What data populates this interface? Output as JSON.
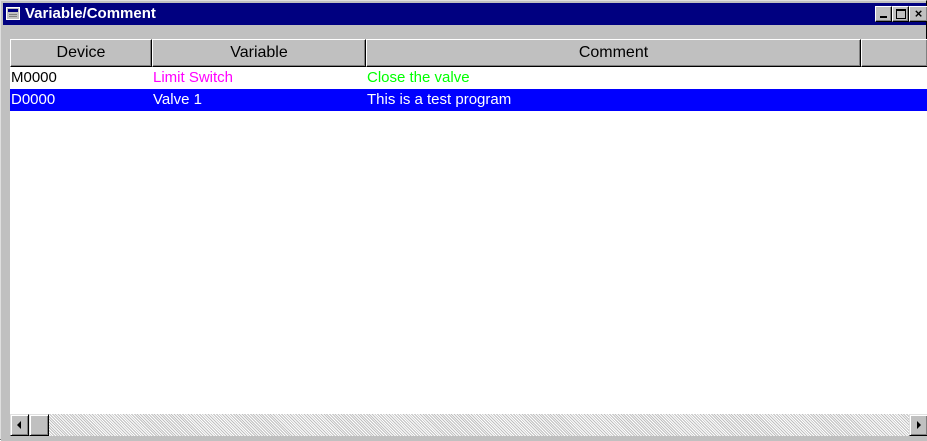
{
  "window": {
    "title": "Variable/Comment",
    "icon": "window-list-icon",
    "controls": {
      "minimize": "minimize",
      "maximize": "maximize",
      "close": "×"
    }
  },
  "table": {
    "columns": [
      "Device",
      "Variable",
      "Comment"
    ],
    "rows": [
      {
        "device": "M0000",
        "variable": "Limit Switch",
        "comment": "Close the valve",
        "selected": false
      },
      {
        "device": "D0000",
        "variable": "Valve 1",
        "comment": "This is a test program",
        "selected": true
      }
    ]
  },
  "colors": {
    "titlebar": "#000080",
    "selection": "#0000ff",
    "variable_text": "#ff00ff",
    "comment_text": "#00ff00",
    "selected_text": "#ffffff"
  },
  "scrollbar": {
    "left_icon": "scroll-left-arrow-icon",
    "right_icon": "scroll-right-arrow-icon"
  }
}
